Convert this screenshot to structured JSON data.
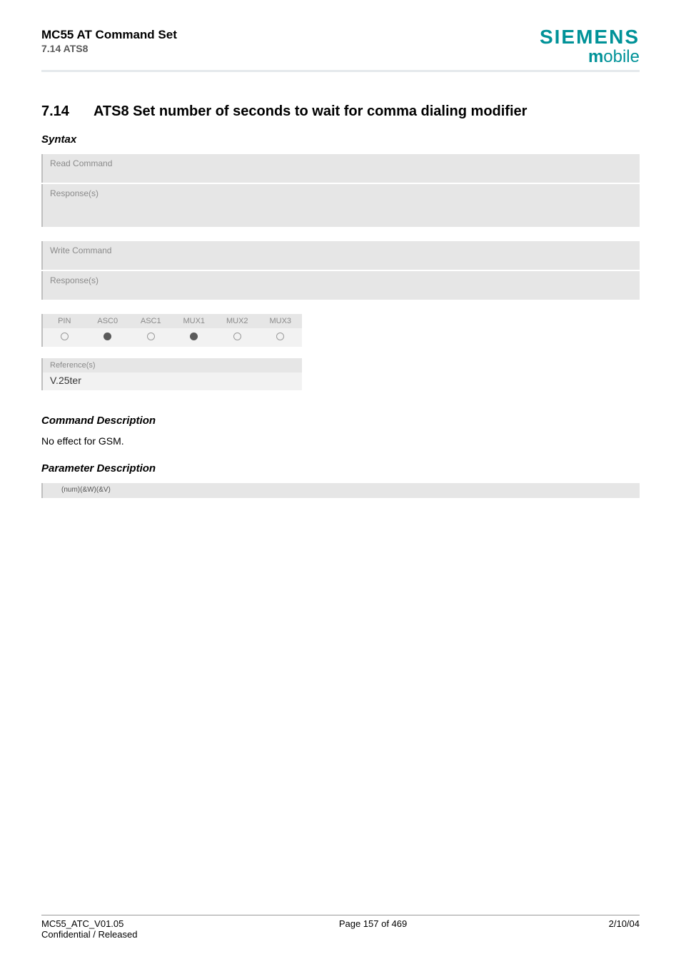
{
  "header": {
    "title": "MC55 AT Command Set",
    "subtitle": "7.14 ATS8",
    "brand_main": "SIEMENS",
    "brand_sub_m": "m",
    "brand_sub_rest": "obile"
  },
  "section": {
    "number": "7.14",
    "title": "ATS8   Set number of seconds to wait for comma dialing modifier"
  },
  "syntax_label": "Syntax",
  "read_block": {
    "label": "Read Command",
    "response_label": "Response(s)"
  },
  "write_block": {
    "label": "Write Command",
    "response_label": "Response(s)"
  },
  "feature_table": {
    "headers": [
      "PIN",
      "ASC0",
      "ASC1",
      "MUX1",
      "MUX2",
      "MUX3"
    ],
    "values": [
      "open",
      "filled",
      "open",
      "filled",
      "open",
      "open"
    ]
  },
  "reference": {
    "label": "Reference(s)",
    "value": "V.25ter"
  },
  "command_desc_label": "Command Description",
  "command_desc_text": "No effect for GSM.",
  "param_desc_label": "Parameter Description",
  "param_box_text": "(num)(&W)(&V)",
  "footer": {
    "left_line1": "MC55_ATC_V01.05",
    "left_line2": "Confidential / Released",
    "center": "Page 157 of 469",
    "right": "2/10/04"
  }
}
